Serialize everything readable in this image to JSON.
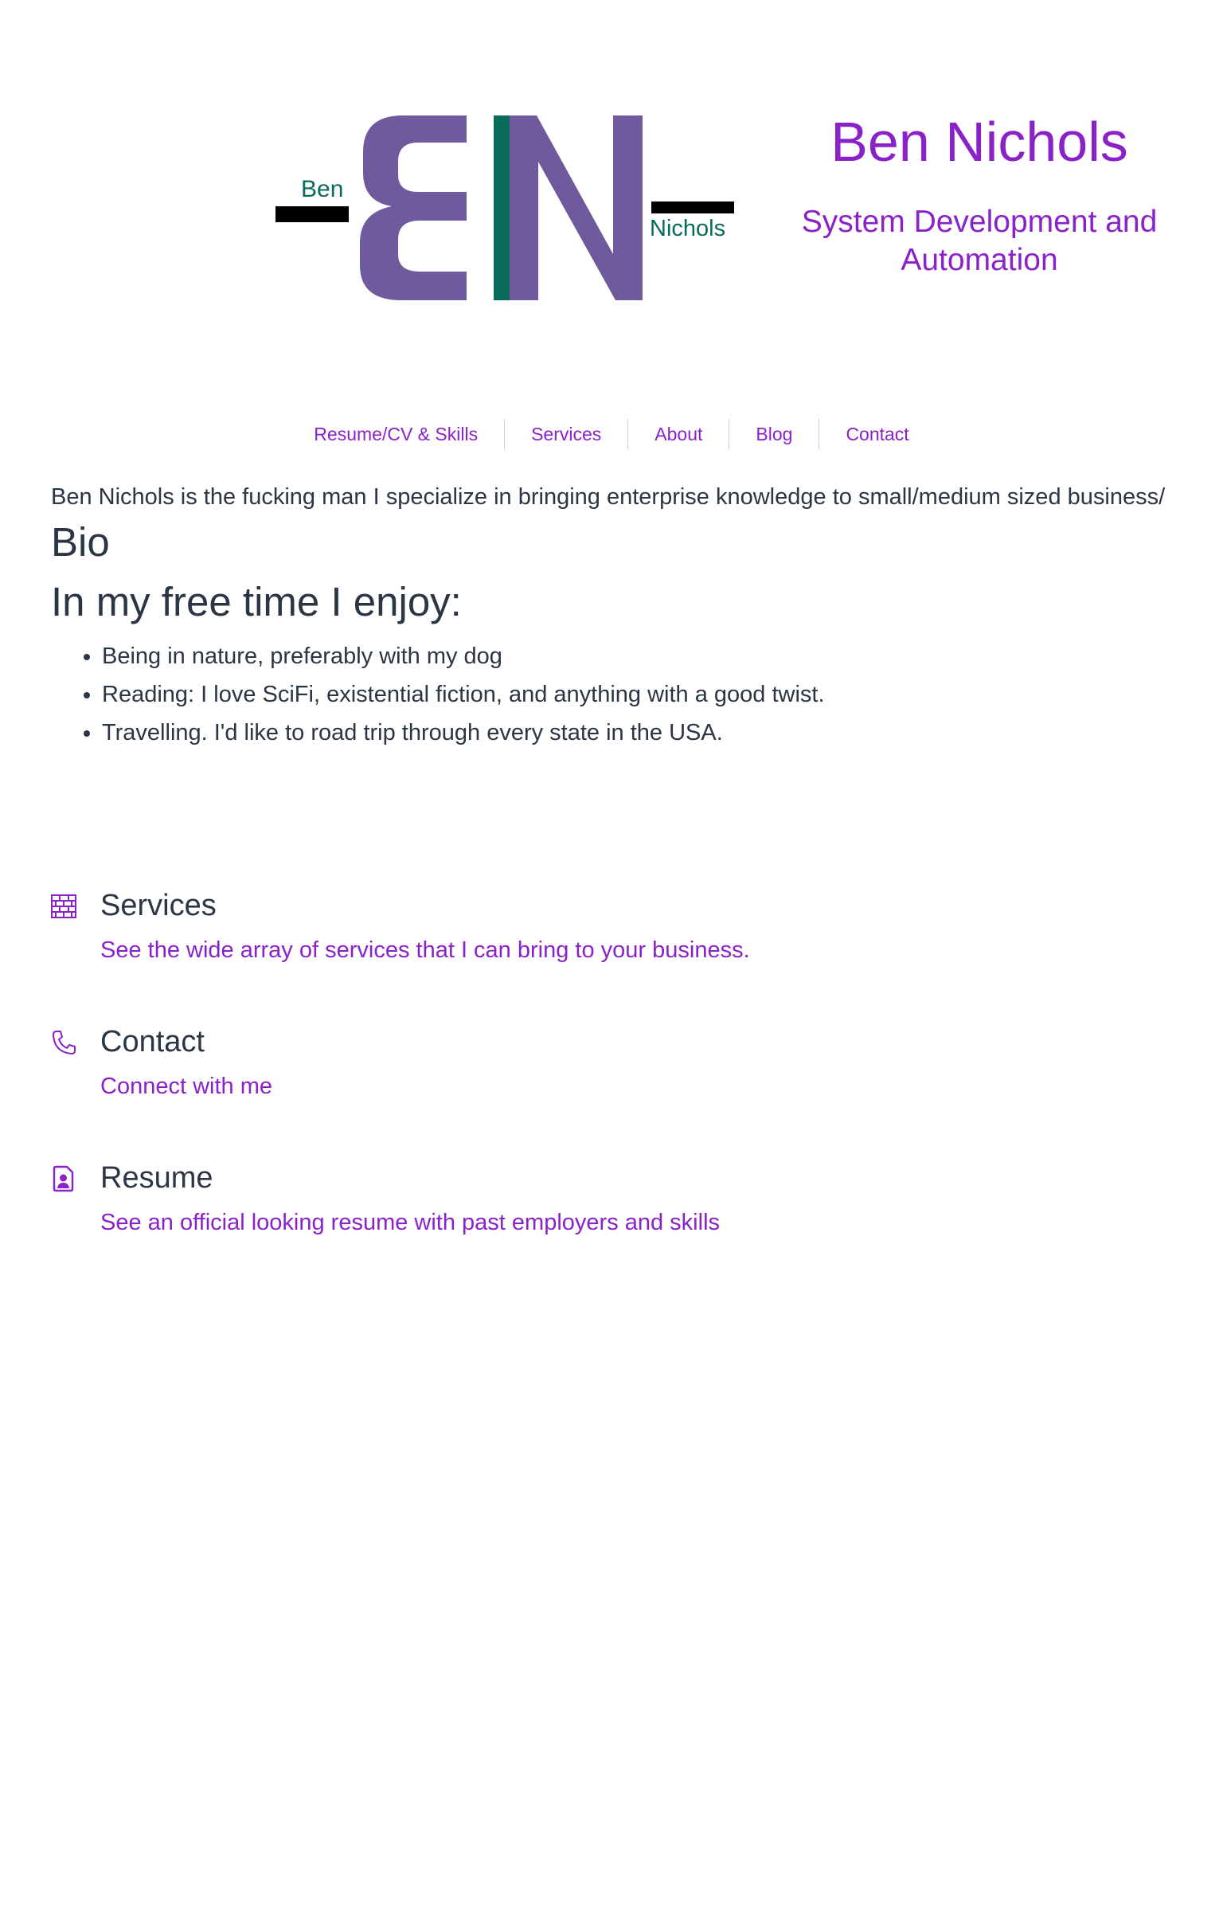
{
  "header": {
    "logo": {
      "left_word": "Ben",
      "right_word": "Nichols",
      "letters": "BN"
    },
    "title": "Ben Nichols",
    "tagline": "System Development and Automation"
  },
  "nav": {
    "items": [
      {
        "label": "Resume/CV & Skills"
      },
      {
        "label": "Services"
      },
      {
        "label": "About"
      },
      {
        "label": "Blog"
      },
      {
        "label": "Contact"
      }
    ]
  },
  "main": {
    "intro": "Ben Nichols is the fucking man I specialize in bringing enterprise knowledge to small/medium sized business/",
    "bio_heading": "Bio",
    "free_time_heading": "In my free time I enjoy:",
    "hobbies": [
      "Being in nature, preferably with my dog",
      "Reading: I love SciFi, existential fiction, and anything with a good twist.",
      "Travelling. I'd like to road trip through every state in the USA."
    ]
  },
  "features": [
    {
      "icon": "brick-wall-icon",
      "title": "Services",
      "description": "See the wide array of services that I can bring to your business."
    },
    {
      "icon": "phone-icon",
      "title": "Contact",
      "description": "Connect with me"
    },
    {
      "icon": "resume-file-icon",
      "title": "Resume",
      "description": "See an official looking resume with past employers and skills"
    }
  ],
  "colors": {
    "accent": "#8b22c9",
    "logo_purple": "#6e5a9c",
    "logo_green": "#0b6b5b",
    "text": "#2b3544"
  }
}
